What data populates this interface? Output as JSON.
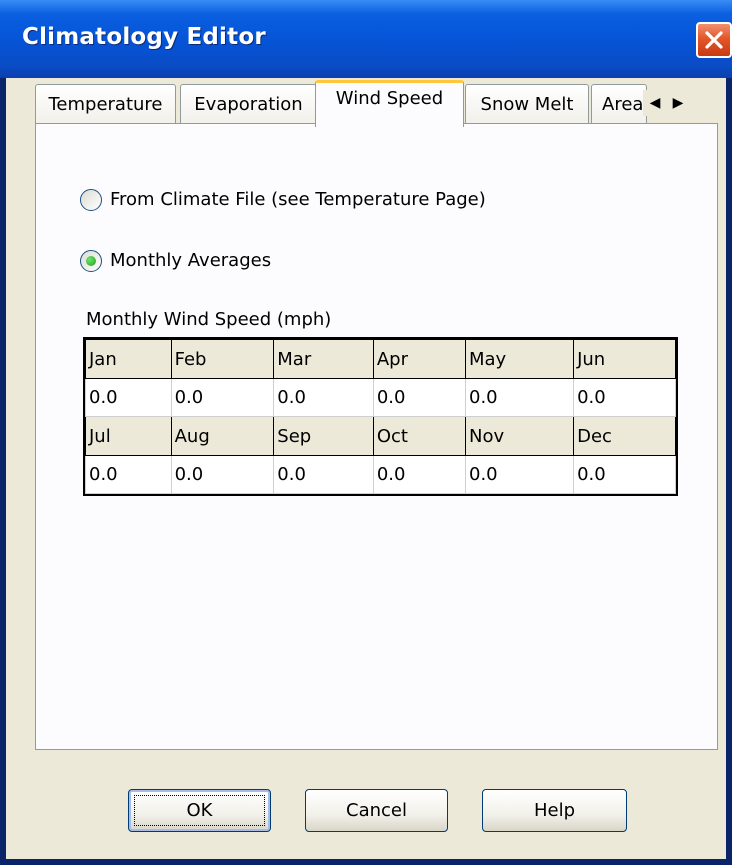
{
  "window": {
    "title": "Climatology Editor"
  },
  "tabs": [
    {
      "label": "Temperature",
      "active": false
    },
    {
      "label": "Evaporation",
      "active": false
    },
    {
      "label": "Wind Speed",
      "active": true
    },
    {
      "label": "Snow Melt",
      "active": false
    },
    {
      "label": "Areal Depletion",
      "active": false
    }
  ],
  "icons": {
    "close": "close-icon",
    "left": "left-arrow-icon",
    "right": "right-arrow-icon"
  },
  "wind_speed": {
    "option_climate_file": "From Climate File (see Temperature Page)",
    "option_monthly_averages": "Monthly Averages",
    "selected": "Monthly Averages",
    "grid_caption": "Monthly Wind Speed (mph)",
    "months_row1": [
      "Jan",
      "Feb",
      "Mar",
      "Apr",
      "May",
      "Jun"
    ],
    "values_row1": [
      "0.0",
      "0.0",
      "0.0",
      "0.0",
      "0.0",
      "0.0"
    ],
    "months_row2": [
      "Jul",
      "Aug",
      "Sep",
      "Oct",
      "Nov",
      "Dec"
    ],
    "values_row2": [
      "0.0",
      "0.0",
      "0.0",
      "0.0",
      "0.0",
      "0.0"
    ]
  },
  "buttons": {
    "ok": "OK",
    "cancel": "Cancel",
    "help": "Help"
  },
  "colors": {
    "title_bar": "#0653d6",
    "face": "#ECE9D8",
    "radio_selected": "#21a121",
    "active_tab_highlight": "#ffc83c"
  }
}
